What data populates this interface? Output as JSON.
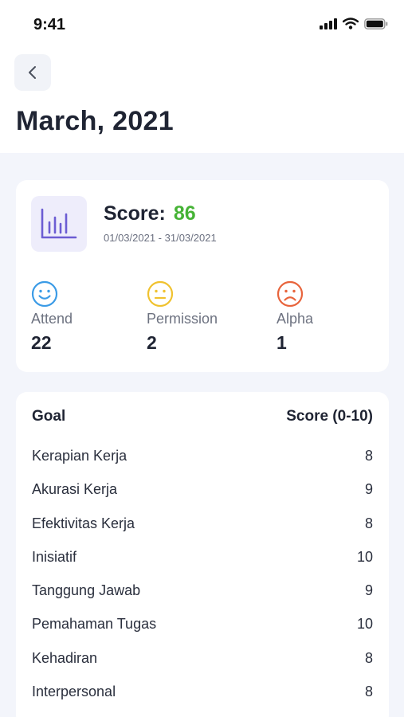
{
  "status_bar": {
    "time": "9:41",
    "icons": [
      "cellular-signal-icon",
      "wifi-icon",
      "battery-icon"
    ]
  },
  "header": {
    "back_icon": "chevron-left-icon",
    "title": "March, 2021"
  },
  "score_card": {
    "icon": "bar-chart-icon",
    "score_label": "Score:",
    "score_value": "86",
    "date_range": "01/03/2021 - 31/03/2021",
    "stats": [
      {
        "icon": "smile-icon",
        "label": "Attend",
        "value": "22",
        "color": "#3b9be6"
      },
      {
        "icon": "neutral-face-icon",
        "label": "Permission",
        "value": "2",
        "color": "#f0c22f"
      },
      {
        "icon": "sad-face-icon",
        "label": "Alpha",
        "value": "1",
        "color": "#e8643c"
      }
    ]
  },
  "goals": {
    "column_goal": "Goal",
    "column_score": "Score (0-10)",
    "rows": [
      {
        "name": "Kerapian Kerja",
        "score": "8"
      },
      {
        "name": "Akurasi Kerja",
        "score": "9"
      },
      {
        "name": "Efektivitas Kerja",
        "score": "8"
      },
      {
        "name": "Inisiatif",
        "score": "10"
      },
      {
        "name": "Tanggung Jawab",
        "score": "9"
      },
      {
        "name": "Pemahaman Tugas",
        "score": "10"
      },
      {
        "name": "Kehadiran",
        "score": "8"
      },
      {
        "name": "Interpersonal",
        "score": "8"
      }
    ]
  },
  "colors": {
    "accent_green": "#46b336",
    "chart_purple": "#6c5dd3",
    "background": "#f3f5fb"
  }
}
